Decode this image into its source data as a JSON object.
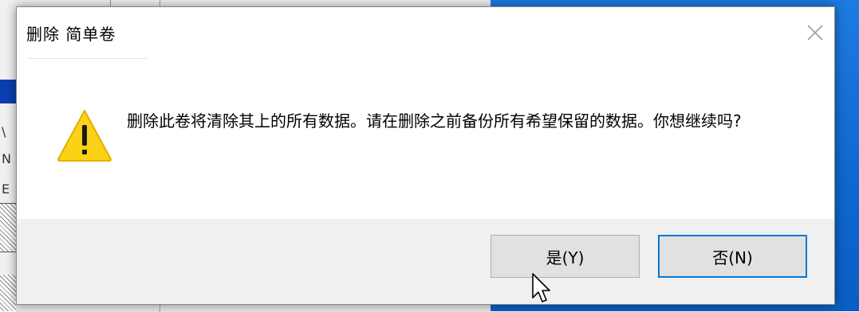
{
  "background": {
    "left_glyphs": [
      "\\",
      "N",
      "E"
    ]
  },
  "dialog": {
    "title": "删除 简单卷",
    "message": "删除此卷将清除其上的所有数据。请在删除之前备份所有希望保留的数据。你想继续吗?",
    "buttons": {
      "yes_label": "是(Y)",
      "no_label": "否(N)"
    },
    "icons": {
      "close": "close-icon",
      "warning": "warning-icon",
      "pointer": "mouse-pointer-icon"
    }
  },
  "colors": {
    "desktop": "#0e67cf",
    "warning_fill": "#fcd116",
    "focus_border": "#0078d7"
  }
}
